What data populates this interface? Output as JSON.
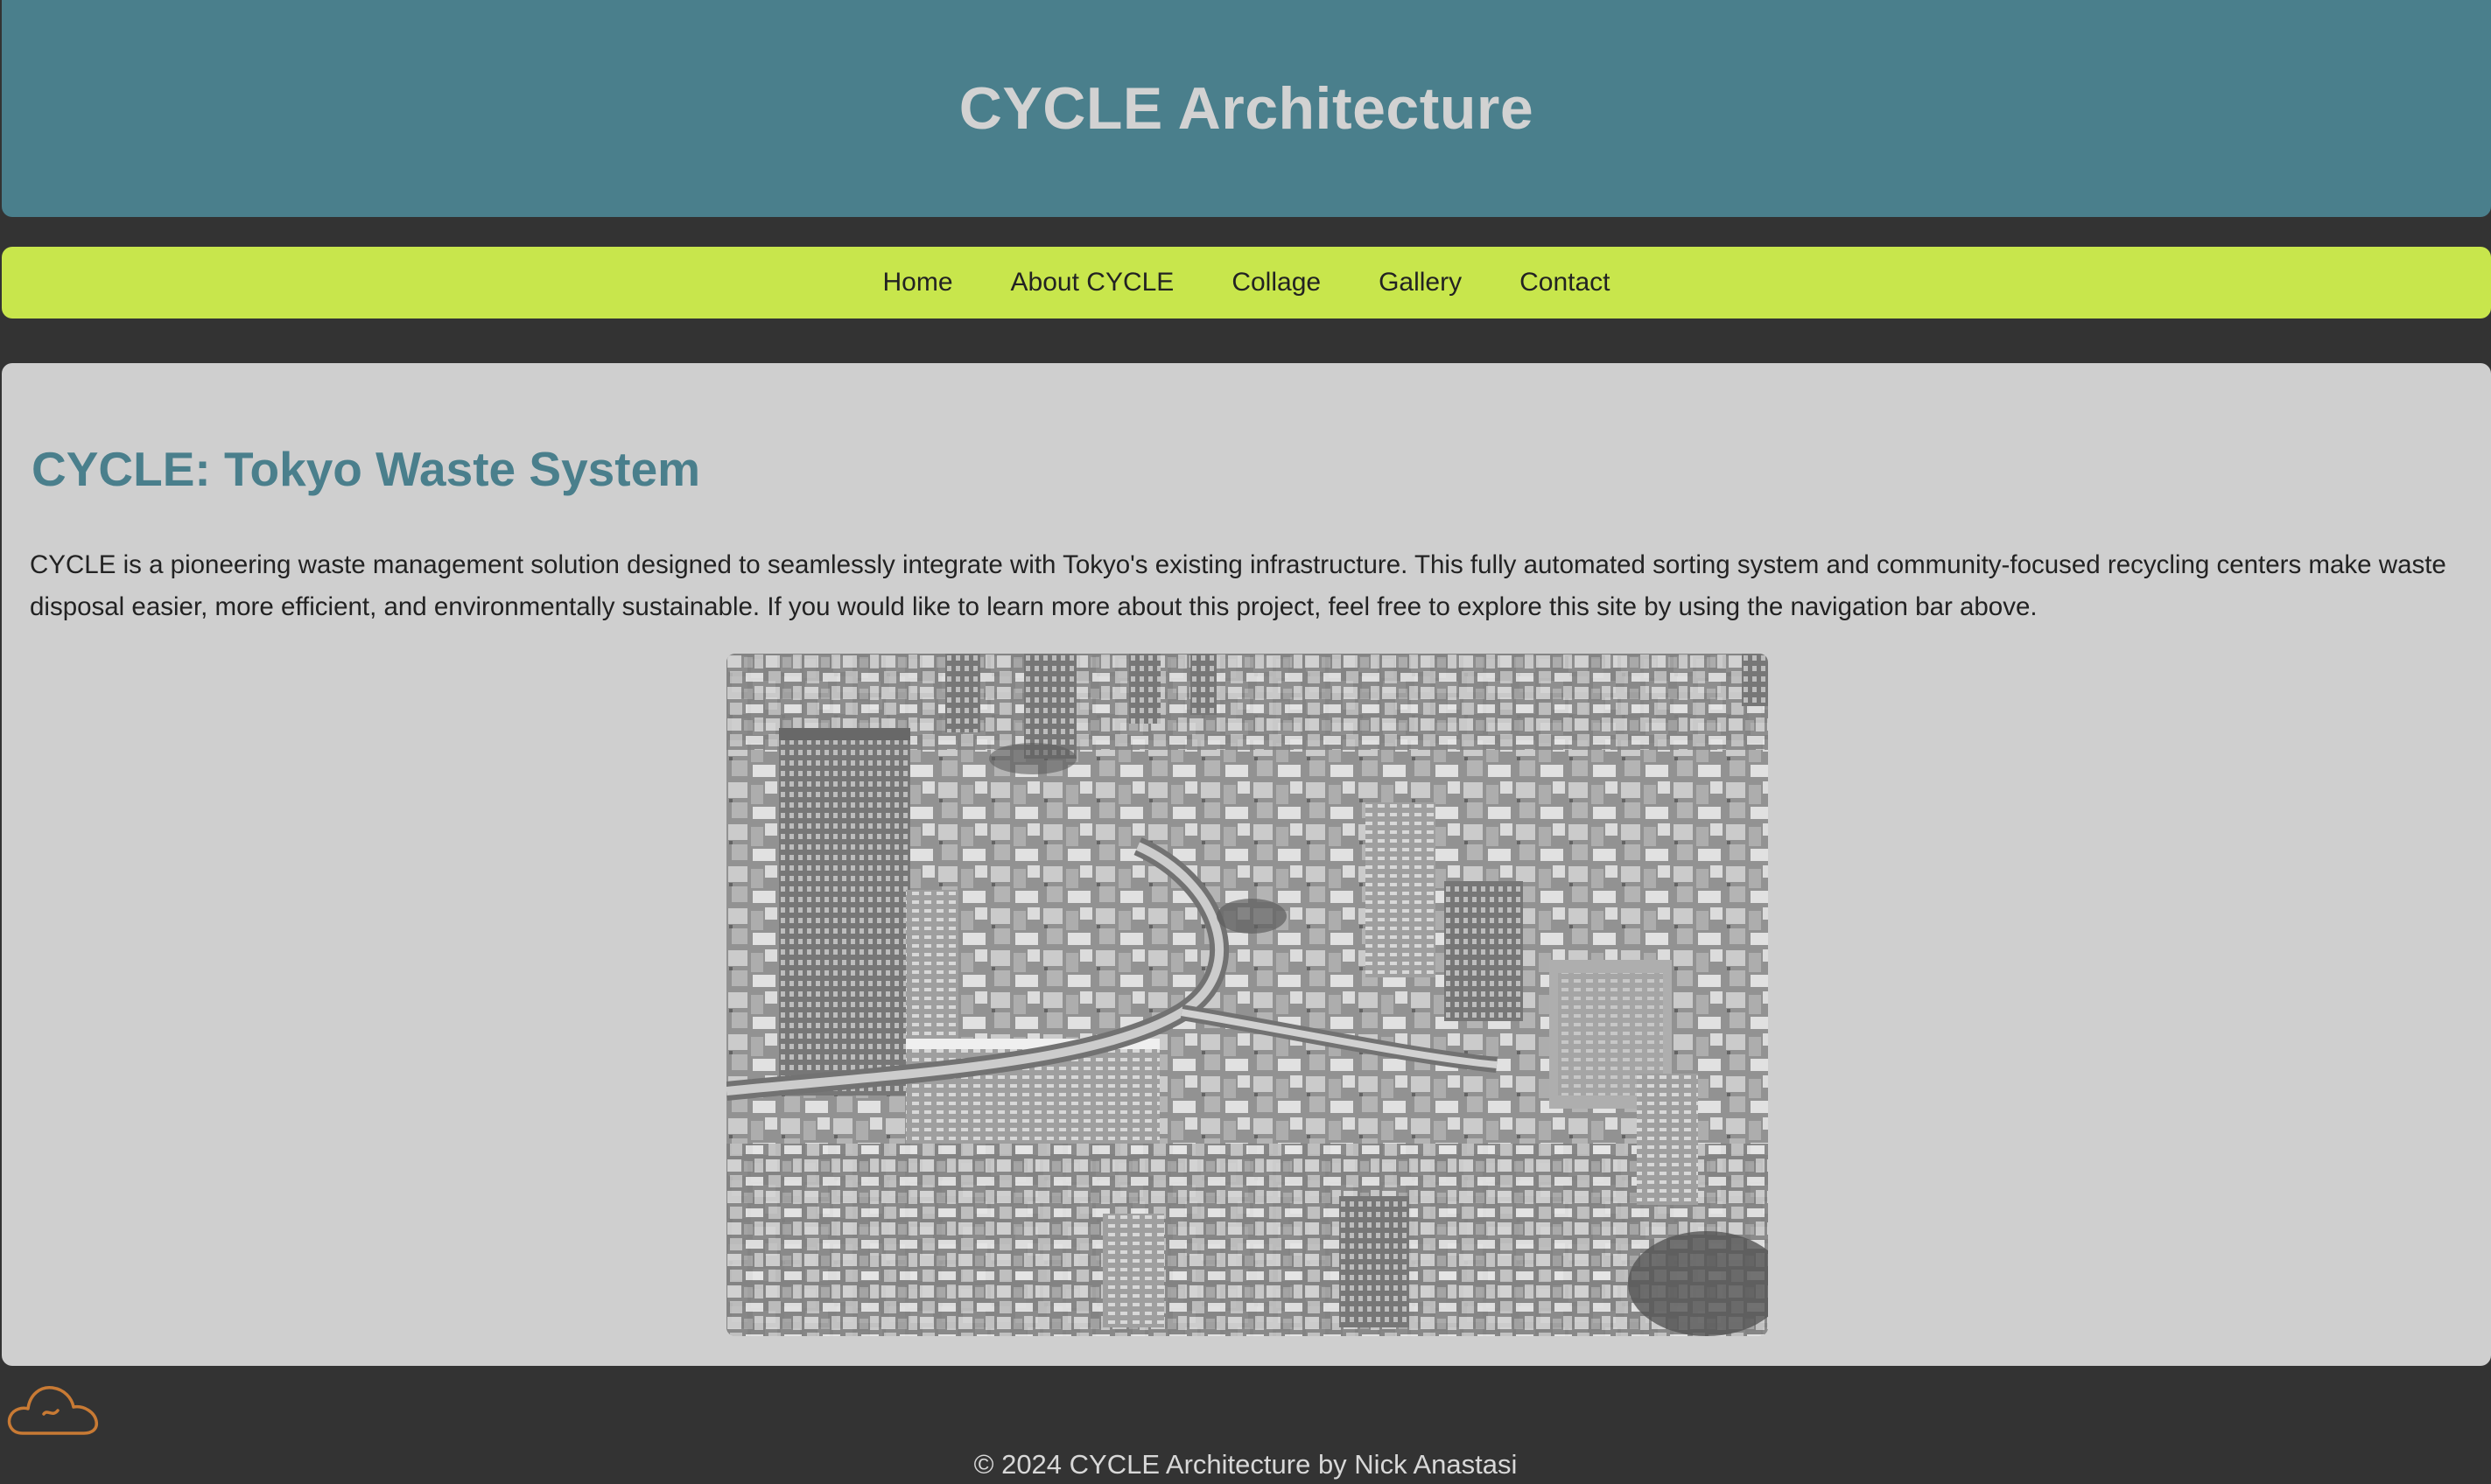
{
  "header": {
    "title": "CYCLE Architecture"
  },
  "nav": {
    "items": [
      {
        "label": "Home"
      },
      {
        "label": "About CYCLE"
      },
      {
        "label": "Collage"
      },
      {
        "label": "Gallery"
      },
      {
        "label": "Contact"
      }
    ]
  },
  "main": {
    "heading": "CYCLE: Tokyo Waste System",
    "paragraph": "CYCLE is a pioneering waste management solution designed to seamlessly integrate with Tokyo's existing infrastructure. This fully automated sorting system and community-focused recycling centers make waste disposal easier, more efficient, and environmentally sustainable. If you would like to learn more about this project, feel free to explore this site by using the navigation bar above.",
    "image": {
      "icon": "city-skyline-photo"
    }
  },
  "widget": {
    "icon": "cloud-icon"
  },
  "footer": {
    "text": "© 2024 CYCLE Architecture by Nick Anastasi"
  },
  "colors": {
    "page_background": "#333333",
    "header_background": "#4a7f8c",
    "nav_background": "#c8e64c",
    "content_background": "#cfcfcf",
    "heading": "#4a7f8c",
    "cloud_icon": "#c87a34"
  }
}
